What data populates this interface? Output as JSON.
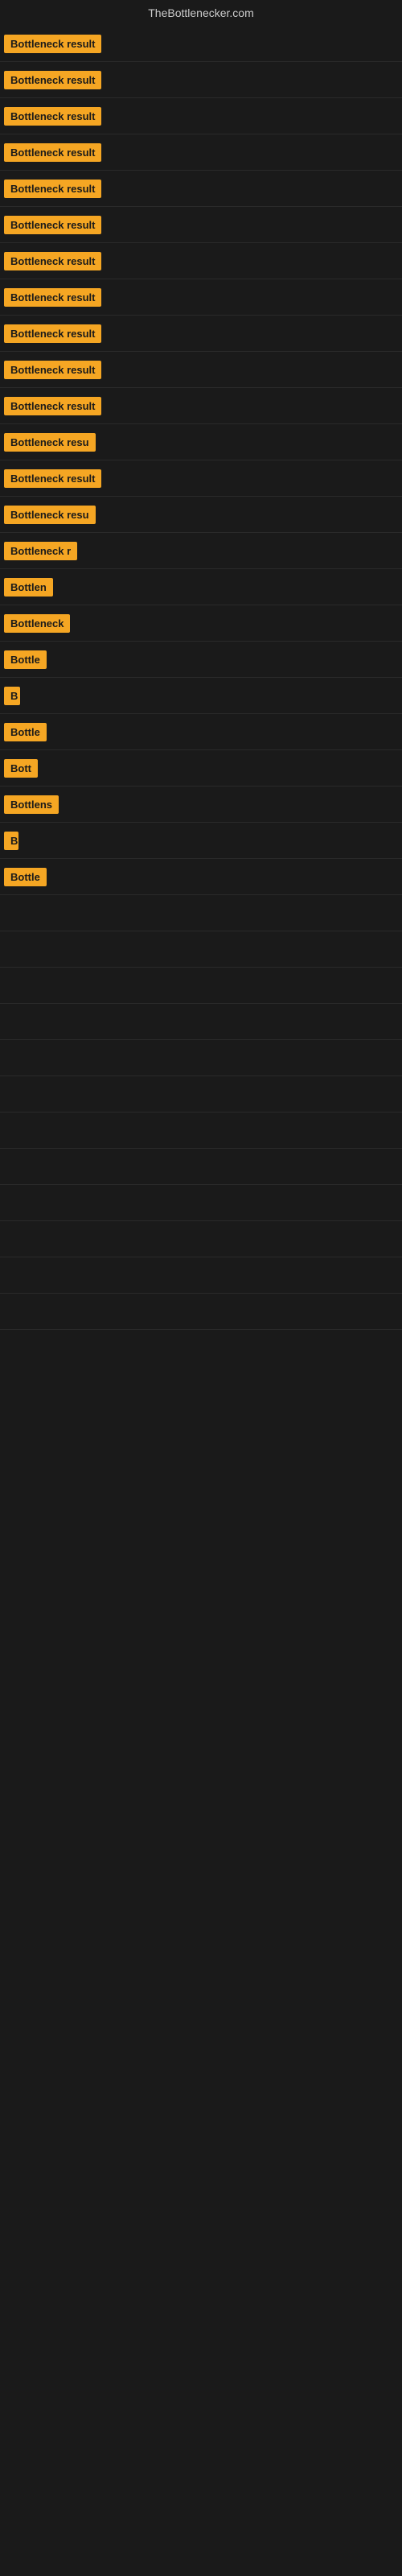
{
  "header": {
    "site_title": "TheBottlenecker.com"
  },
  "rows": [
    {
      "id": 1,
      "badge_text": "Bottleneck result",
      "badge_width": 160
    },
    {
      "id": 2,
      "badge_text": "Bottleneck result",
      "badge_width": 160
    },
    {
      "id": 3,
      "badge_text": "Bottleneck result",
      "badge_width": 160
    },
    {
      "id": 4,
      "badge_text": "Bottleneck result",
      "badge_width": 160
    },
    {
      "id": 5,
      "badge_text": "Bottleneck result",
      "badge_width": 160
    },
    {
      "id": 6,
      "badge_text": "Bottleneck result",
      "badge_width": 160
    },
    {
      "id": 7,
      "badge_text": "Bottleneck result",
      "badge_width": 160
    },
    {
      "id": 8,
      "badge_text": "Bottleneck result",
      "badge_width": 160
    },
    {
      "id": 9,
      "badge_text": "Bottleneck result",
      "badge_width": 160
    },
    {
      "id": 10,
      "badge_text": "Bottleneck result",
      "badge_width": 160
    },
    {
      "id": 11,
      "badge_text": "Bottleneck result",
      "badge_width": 160
    },
    {
      "id": 12,
      "badge_text": "Bottleneck resu",
      "badge_width": 140
    },
    {
      "id": 13,
      "badge_text": "Bottleneck result",
      "badge_width": 155
    },
    {
      "id": 14,
      "badge_text": "Bottleneck resu",
      "badge_width": 138
    },
    {
      "id": 15,
      "badge_text": "Bottleneck r",
      "badge_width": 100
    },
    {
      "id": 16,
      "badge_text": "Bottlen",
      "badge_width": 70
    },
    {
      "id": 17,
      "badge_text": "Bottleneck",
      "badge_width": 85
    },
    {
      "id": 18,
      "badge_text": "Bottle",
      "badge_width": 60
    },
    {
      "id": 19,
      "badge_text": "B",
      "badge_width": 20
    },
    {
      "id": 20,
      "badge_text": "Bottle",
      "badge_width": 58
    },
    {
      "id": 21,
      "badge_text": "Bott",
      "badge_width": 45
    },
    {
      "id": 22,
      "badge_text": "Bottlens",
      "badge_width": 72
    },
    {
      "id": 23,
      "badge_text": "B",
      "badge_width": 18
    },
    {
      "id": 24,
      "badge_text": "Bottle",
      "badge_width": 60
    },
    {
      "id": 25,
      "badge_text": "",
      "badge_width": 0
    },
    {
      "id": 26,
      "badge_text": "",
      "badge_width": 0
    },
    {
      "id": 27,
      "badge_text": "",
      "badge_width": 0
    },
    {
      "id": 28,
      "badge_text": "",
      "badge_width": 0
    },
    {
      "id": 29,
      "badge_text": "",
      "badge_width": 0
    },
    {
      "id": 30,
      "badge_text": "",
      "badge_width": 0
    },
    {
      "id": 31,
      "badge_text": "",
      "badge_width": 0
    },
    {
      "id": 32,
      "badge_text": "",
      "badge_width": 0
    },
    {
      "id": 33,
      "badge_text": "",
      "badge_width": 0
    },
    {
      "id": 34,
      "badge_text": "",
      "badge_width": 0
    },
    {
      "id": 35,
      "badge_text": "",
      "badge_width": 0
    },
    {
      "id": 36,
      "badge_text": "",
      "badge_width": 0
    }
  ]
}
